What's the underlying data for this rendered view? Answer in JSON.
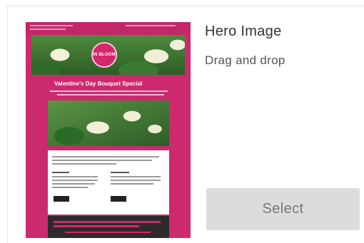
{
  "template": {
    "name": "Hero Image",
    "description": "Drag and drop",
    "select_label": "Select",
    "preview": {
      "logo_text": "IN BLOOM",
      "headline": "Valentine's Day Bouquet Special",
      "brand_color": "#cc2a6e"
    }
  }
}
